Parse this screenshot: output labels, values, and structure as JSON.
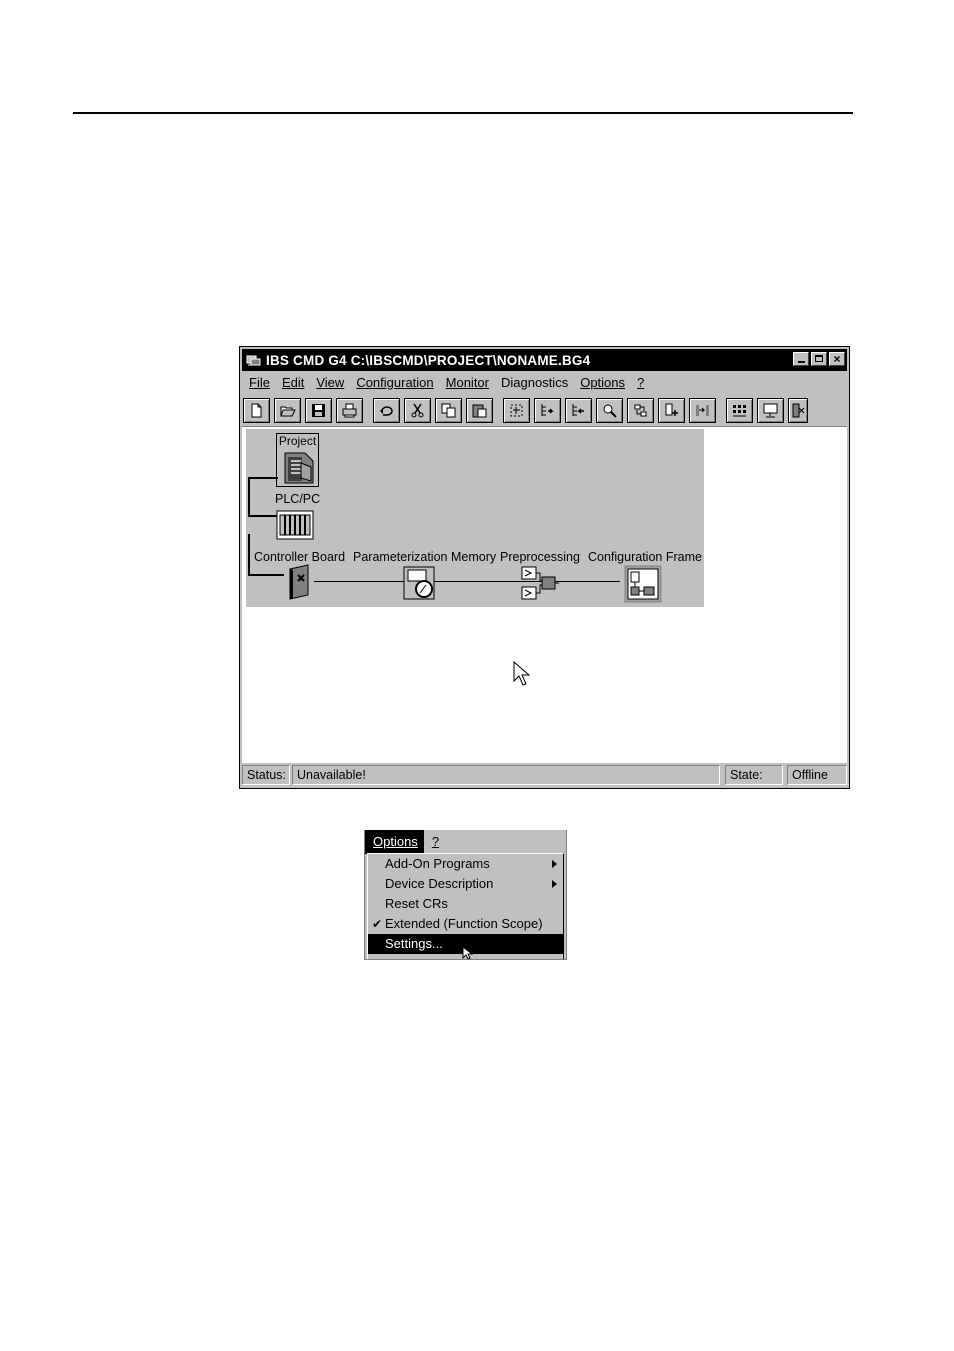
{
  "window": {
    "title": "IBS CMD G4 C:\\IBSCMD\\PROJECT\\NONAME.BG4",
    "close_glyph": "×"
  },
  "menubar": [
    {
      "label": "File"
    },
    {
      "label": "Edit"
    },
    {
      "label": "View"
    },
    {
      "label": "Configuration"
    },
    {
      "label": "Monitor"
    },
    {
      "label": "Diagnostics"
    },
    {
      "label": "Options"
    },
    {
      "label": "?"
    }
  ],
  "toolbar_icons": [
    "new-file-icon",
    "open-folder-icon",
    "save-icon",
    "print-icon",
    "undo-icon",
    "cut-icon",
    "copy-icon",
    "paste-icon",
    "select-icon",
    "insert-after-icon",
    "insert-before-icon",
    "search-device-icon",
    "replace-icon",
    "add-module-icon",
    "connect-icon",
    "bus-structure-icon",
    "monitor-icon",
    "diagnostic-icon"
  ],
  "diagram": {
    "project": "Project",
    "plc": "PLC/PC",
    "controller": "Controller Board",
    "param_memory": "Parameterization Memory",
    "preprocessing": "Preprocessing",
    "config_frame": "Configuration Frame"
  },
  "statusbar": {
    "status_label": "Status:",
    "status_value": "Unavailable!",
    "state_label": "State:",
    "state_value": "Offline"
  },
  "options_menu": {
    "bar": [
      "Options",
      "?"
    ],
    "items": [
      {
        "label": "Add-On Programs",
        "submenu": true,
        "checked": false
      },
      {
        "label": "Device Description",
        "submenu": true,
        "checked": false
      },
      {
        "label": "Reset CRs",
        "submenu": false,
        "checked": false
      },
      {
        "label": "Extended (Function Scope)",
        "submenu": false,
        "checked": true
      },
      {
        "label": "Settings...",
        "submenu": false,
        "checked": false,
        "selected": true
      }
    ],
    "check_glyph": "✔"
  }
}
